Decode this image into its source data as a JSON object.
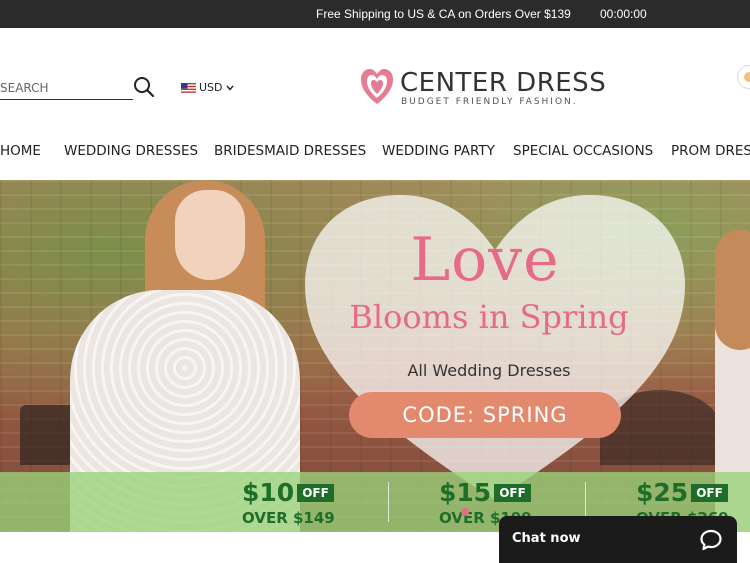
{
  "announcement": {
    "shipping_text": "Free Shipping to US & CA on Orders Over $139",
    "countdown": "00:00:00"
  },
  "header": {
    "search_placeholder": "SEARCH",
    "currency": "USD",
    "logo_title": "CENTER DRESS",
    "logo_tagline": "BUDGET FRIENDLY FASHION."
  },
  "nav": {
    "items": [
      {
        "label": "HOME"
      },
      {
        "label": "WEDDING DRESSES"
      },
      {
        "label": "BRIDESMAID DRESSES"
      },
      {
        "label": "WEDDING PARTY"
      },
      {
        "label": "SPECIAL OCCASIONS"
      },
      {
        "label": "PROM DRES"
      }
    ]
  },
  "hero": {
    "line1": "Love",
    "line2": "Blooms in Spring",
    "line3": "All Wedding Dresses",
    "code": "CODE: SPRING",
    "offers": [
      {
        "amount": "$10",
        "off": "OFF",
        "threshold": "OVER $149"
      },
      {
        "amount": "$15",
        "off": "OFF",
        "threshold": "OVER $199"
      },
      {
        "amount": "$25",
        "off": "OFF",
        "threshold": "OVER $269"
      }
    ]
  },
  "chat": {
    "label": "Chat now"
  },
  "colors": {
    "accent_pink": "#e56b86",
    "code_pill": "#e38a6e",
    "offer_green": "#1e6e2a",
    "topbar": "#2b2b2b"
  }
}
